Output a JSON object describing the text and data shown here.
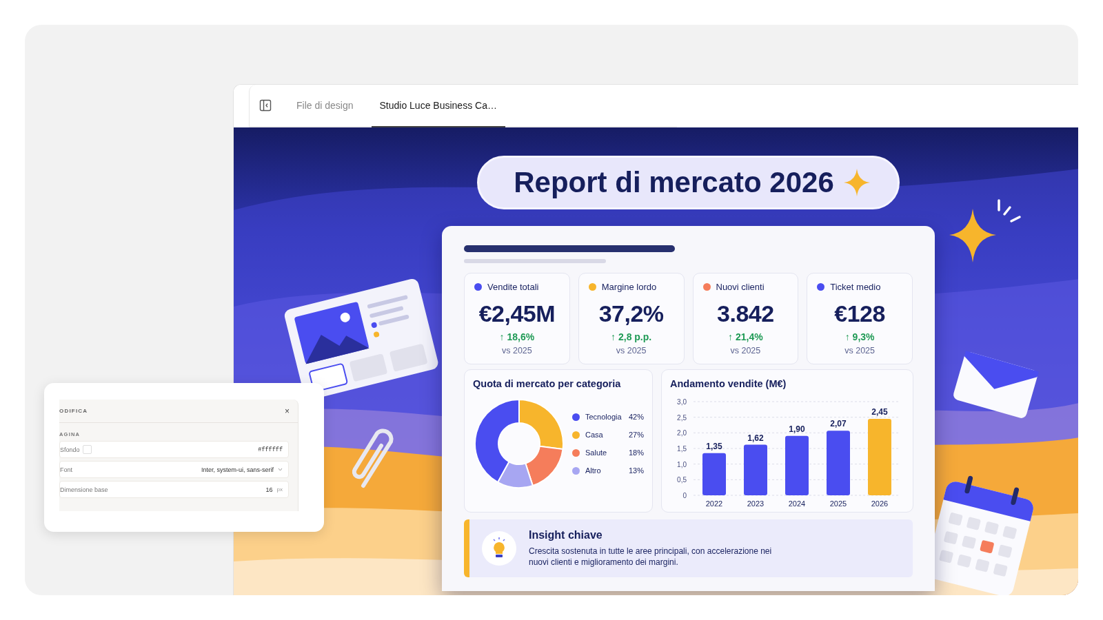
{
  "tabs": [
    {
      "label": "File di design",
      "selected": false
    },
    {
      "label": "Studio Luce Business Ca…",
      "selected": true
    }
  ],
  "report": {
    "title": "Report di mercato 2026",
    "kpis": [
      {
        "label": "Vendite totali",
        "color": "#4a4df0",
        "value": "€2,45M",
        "change": "↑ 18,6%",
        "compare": "vs 2025"
      },
      {
        "label": "Margine lordo",
        "color": "#f7b52c",
        "value": "37,2%",
        "change": "↑ 2,8 p.p.",
        "compare": "vs 2025"
      },
      {
        "label": "Nuovi clienti",
        "color": "#f57d5b",
        "value": "3.842",
        "change": "↑ 21,4%",
        "compare": "vs 2025"
      },
      {
        "label": "Ticket medio",
        "color": "#4a4df0",
        "value": "€128",
        "change": "↑ 9,3%",
        "compare": "vs 2025"
      }
    ],
    "share": {
      "title": "Quota di mercato per categoria",
      "legend": [
        {
          "color": "#4a4df0",
          "value": "42%"
        },
        {
          "color": "#f7b52c",
          "value": "27%"
        },
        {
          "color": "#f57d5b",
          "value": "18%"
        },
        {
          "color": "#a7a6f2",
          "value": "13%"
        }
      ],
      "chart_data": {
        "type": "donut",
        "categories": [
          "Tecnologia",
          "Casa",
          "Salute",
          "Altro"
        ],
        "values": [
          42,
          27,
          18,
          13
        ]
      }
    },
    "sales": {
      "title": "Andamento vendite (M€)",
      "chart_data": {
        "type": "bar",
        "categories": [
          "2022",
          "2023",
          "2024",
          "2025",
          "2026"
        ],
        "series": [
          {
            "colors": [
              "#4a4df0",
              "#4a4df0",
              "#4a4df0",
              "#4a4df0",
              "#f7b52c"
            ],
            "values": [
              1.35,
              1.62,
              1.9,
              2.07,
              2.45
            ]
          }
        ],
        "grid": true,
        "ylim": [
          0,
          3
        ],
        "yticks": [
          {
            "value": 0,
            "label": "0"
          },
          {
            "value": 0.5,
            "label": "0,5"
          },
          {
            "value": 1,
            "label": "1,0"
          },
          {
            "value": 1.5,
            "label": "1,5"
          },
          {
            "value": 2,
            "label": "2,0"
          },
          {
            "value": 2.5,
            "label": "2,5"
          },
          {
            "value": 3,
            "label": "3,0"
          }
        ],
        "value_labels": [
          "1,35",
          "1,62",
          "1,90",
          "2,07",
          "2,45"
        ]
      }
    },
    "insight": {
      "title": "Insight chiave",
      "text": "Crescita sostenuta in tutte le aree principali, con accelerazione nei nuovi clienti e miglioramento dei margini."
    }
  },
  "edit_panel": {
    "title": "ODIFICA",
    "close": "×",
    "section": "AGINA",
    "rows": [
      {
        "kind": "color",
        "label": "Sfondo",
        "value": "#ffffff"
      },
      {
        "kind": "select",
        "label": "Font",
        "value": "Inter, system-ui, sans-serif"
      },
      {
        "kind": "number",
        "label": "Dimensione base",
        "value": "16",
        "unit": "px"
      }
    ]
  }
}
